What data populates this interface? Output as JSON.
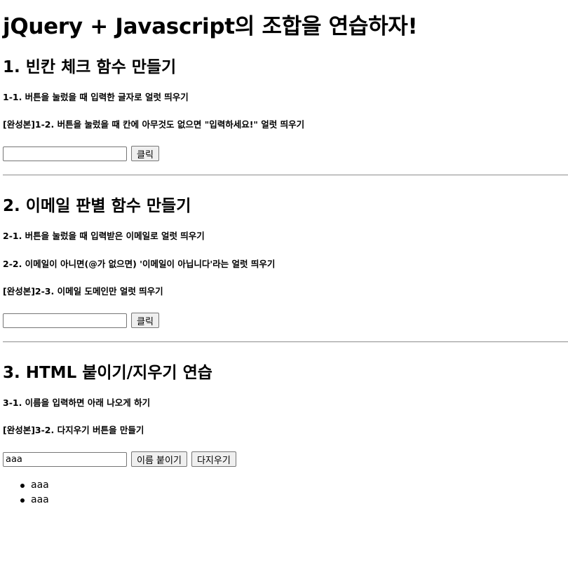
{
  "page_title": "jQuery + Javascript의 조합을 연습하자!",
  "section1": {
    "title": "1. 빈칸 체크 함수 만들기",
    "desc1": "1-1. 버튼을 눌렀을 때 입력한 글자로 얼럿 띄우기",
    "desc2": "[완성본]1-2. 버튼을 눌렀을 때 칸에 아무것도 없으면 \"입력하세요!\" 얼럿 띄우기",
    "input_value": "",
    "button_label": "클릭"
  },
  "section2": {
    "title": "2. 이메일 판별 함수 만들기",
    "desc1": "2-1. 버튼을 눌렀을 때 입력받은 이메일로 얼럿 띄우기",
    "desc2": "2-2. 이메일이 아니면(@가 없으면) '이메일이 아닙니다'라는 얼럿 띄우기",
    "desc3": "[완성본]2-3. 이메일 도메인만 얼럿 띄우기",
    "input_value": "",
    "button_label": "클릭"
  },
  "section3": {
    "title": "3. HTML 붙이기/지우기 연습",
    "desc1": "3-1. 이름을 입력하면 아래 나오게 하기",
    "desc2": "[완성본]3-2. 다지우기 버튼을 만들기",
    "input_value": "aaa",
    "append_button_label": "이름 붙이기",
    "clear_button_label": "다지우기",
    "names": [
      "aaa",
      "aaa"
    ]
  }
}
